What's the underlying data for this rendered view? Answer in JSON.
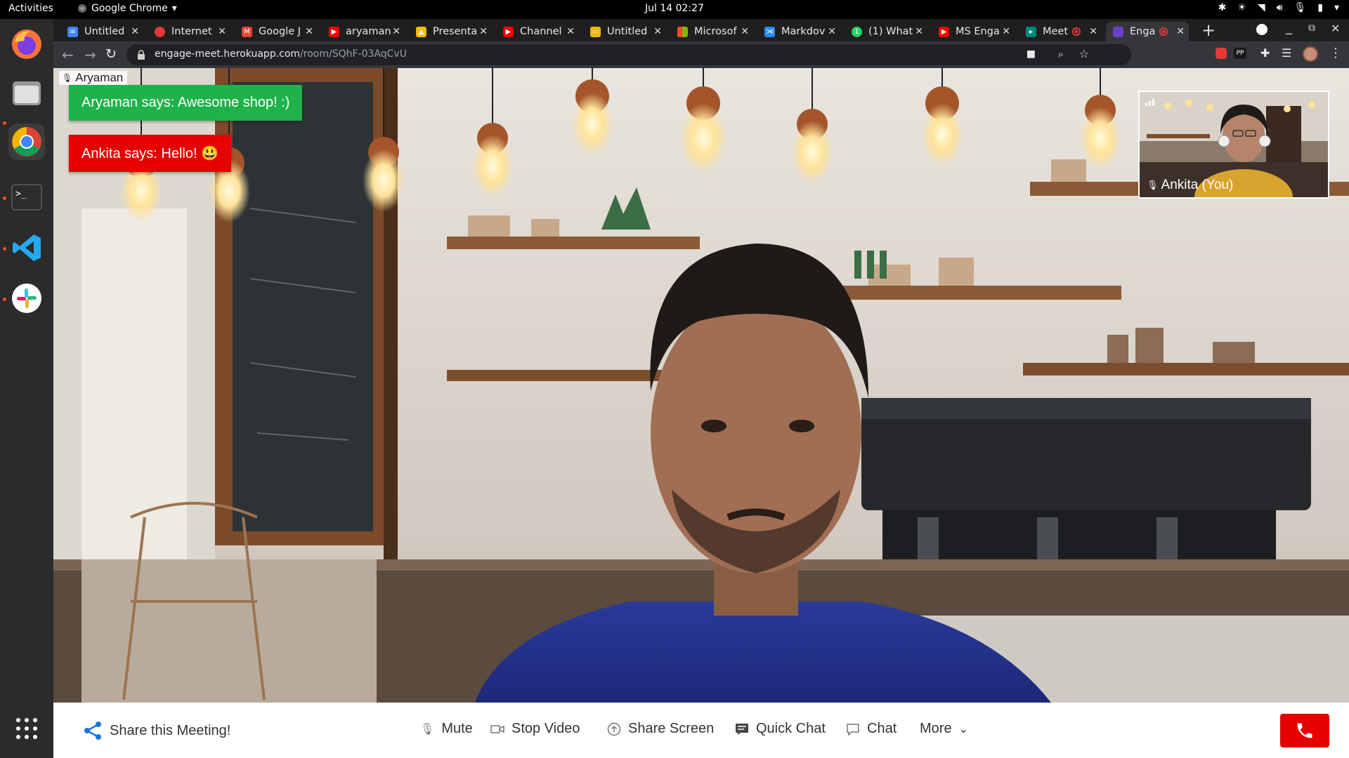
{
  "os": {
    "activities": "Activities",
    "app_name": "Google Chrome",
    "clock": "Jul 14  02:27"
  },
  "browser": {
    "tabs": [
      {
        "label": "Untitled",
        "icon": "docs-icon",
        "color": "#4285f4"
      },
      {
        "label": "Internet",
        "icon": "speed-icon",
        "color": "#e53935"
      },
      {
        "label": "Google J",
        "icon": "gmail-icon",
        "color": "#ea4335"
      },
      {
        "label": "aryaman",
        "icon": "youtube-icon",
        "color": "#ff0000"
      },
      {
        "label": "Presenta",
        "icon": "drive-icon",
        "color": "#fbbc04"
      },
      {
        "label": "Channel",
        "icon": "youtube-icon",
        "color": "#ff0000"
      },
      {
        "label": "Untitled",
        "icon": "slides-icon",
        "color": "#f4b400"
      },
      {
        "label": "Microsof",
        "icon": "microsoft-icon",
        "color": "#7fba00"
      },
      {
        "label": "Markdov",
        "icon": "vscode-icon",
        "color": "#2d8cf0"
      },
      {
        "label": "(1) What",
        "icon": "whatsapp-icon",
        "color": "#25d366"
      },
      {
        "label": "MS Enga",
        "icon": "youtube-icon",
        "color": "#ff0000"
      },
      {
        "label": "Meet",
        "icon": "meet-icon",
        "color": "#00897b"
      },
      {
        "label": "Enga",
        "icon": "engage-icon",
        "color": "#6a3fc8"
      }
    ],
    "url_host": "engage-meet.herokuapp.com",
    "url_path": "/room/SQhF-03AqCvU"
  },
  "meeting": {
    "remote_name": "Aryaman",
    "self_name": "Ankita (You)",
    "messages": [
      {
        "text": "Aryaman says: Awesome shop! :)",
        "color": "#1fb24a"
      },
      {
        "text": "Ankita says: Hello! 😃",
        "color": "#e60000"
      }
    ],
    "controls": {
      "share": "Share this Meeting!",
      "mute": "Mute",
      "stop_video": "Stop Video",
      "share_screen": "Share Screen",
      "quick_chat": "Quick Chat",
      "chat": "Chat",
      "more": "More"
    },
    "end_call_color": "#e60000"
  }
}
